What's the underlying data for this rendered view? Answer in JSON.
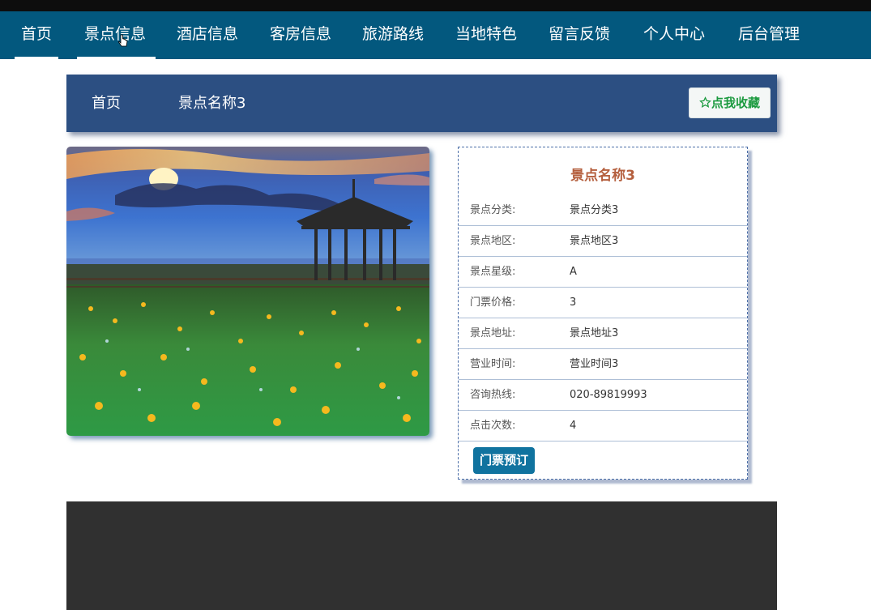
{
  "nav": {
    "items": [
      {
        "label": "首页"
      },
      {
        "label": "景点信息"
      },
      {
        "label": "酒店信息"
      },
      {
        "label": "客房信息"
      },
      {
        "label": "旅游路线"
      },
      {
        "label": "当地特色"
      },
      {
        "label": "留言反馈"
      },
      {
        "label": "个人中心"
      },
      {
        "label": "后台管理"
      }
    ],
    "active_index": 1
  },
  "breadcrumb": {
    "home": "首页",
    "separator": "/",
    "current": "景点名称3"
  },
  "favorite_button": {
    "label": "点我收藏",
    "icon": "star-outline-icon"
  },
  "detail": {
    "title": "景点名称3",
    "rows": [
      {
        "label": "景点分类:",
        "value": "景点分类3"
      },
      {
        "label": "景点地区:",
        "value": "景点地区3"
      },
      {
        "label": "景点星级:",
        "value": "A"
      },
      {
        "label": "门票价格:",
        "value": "3"
      },
      {
        "label": "景点地址:",
        "value": "景点地址3"
      },
      {
        "label": "营业时间:",
        "value": "营业时间3"
      },
      {
        "label": "咨询热线:",
        "value": "020-89819993"
      },
      {
        "label": "点击次数:",
        "value": "4"
      }
    ],
    "book_button": "门票预订"
  },
  "colors": {
    "nav_bg": "#03587e",
    "breadcrumb_bg": "#2c4f82",
    "title_color": "#b5603f",
    "favorite_text": "#1b9a3f",
    "book_bg": "#10739f",
    "footer_bg": "#303030"
  }
}
